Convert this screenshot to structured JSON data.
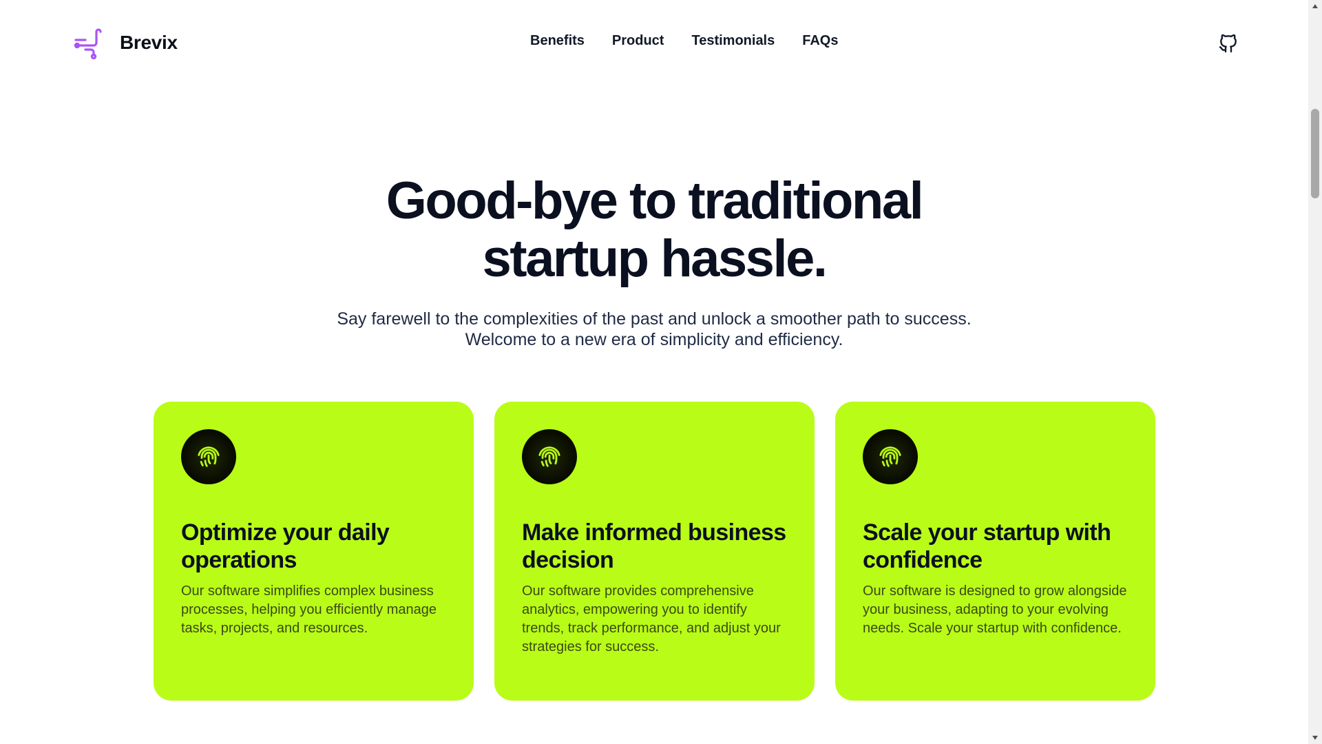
{
  "header": {
    "brand_name": "Brevix",
    "brand_color": "#a855f7",
    "nav": [
      {
        "label": "Benefits"
      },
      {
        "label": "Product"
      },
      {
        "label": "Testimonials"
      },
      {
        "label": "FAQs"
      }
    ],
    "github_icon": "github-icon"
  },
  "hero": {
    "title_line1": "Good-bye to traditional",
    "title_line2": "startup hassle.",
    "subtitle_line1": "Say farewell to the complexities of the past and unlock a smoother path to success.",
    "subtitle_line2": "Welcome to a new era of simplicity and efficiency."
  },
  "cards": [
    {
      "icon": "fingerprint-icon",
      "title": "Optimize your daily operations",
      "text": "Our software simplifies complex business processes, helping you efficiently manage tasks, projects, and resources."
    },
    {
      "icon": "fingerprint-icon",
      "title": "Make informed business decision",
      "text": "Our software provides comprehensive analytics, empowering you to identify trends, track performance, and adjust your strategies for success."
    },
    {
      "icon": "fingerprint-icon",
      "title": "Scale your startup with confidence",
      "text": "Our software is designed to grow alongside your business, adapting to your evolving needs. Scale your startup with confidence."
    }
  ],
  "colors": {
    "card_background": "#b9fc18",
    "icon_glow": "#b9fc18",
    "heading": "#0b1020"
  }
}
